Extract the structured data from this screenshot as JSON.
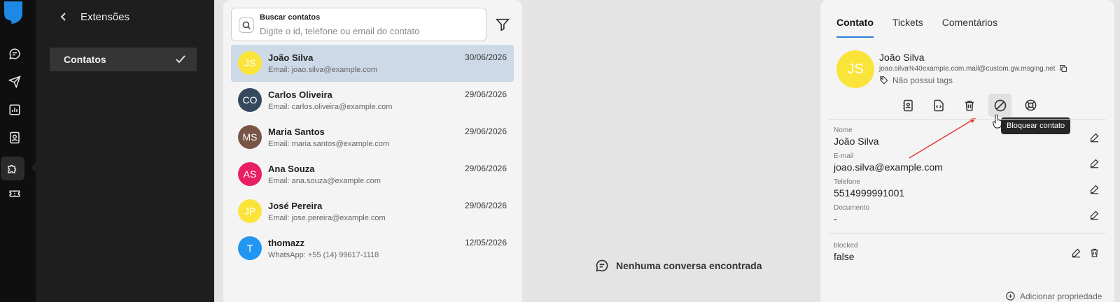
{
  "extensions": {
    "title": "Extensões",
    "items": [
      {
        "label": "Contatos"
      }
    ]
  },
  "search": {
    "label": "Buscar contatos",
    "placeholder": "Digite o id, telefone ou email do contato"
  },
  "contacts": [
    {
      "initials": "JS",
      "name": "João Silva",
      "sub": "Email: joao.silva@example.com",
      "date": "30/06/2026",
      "color": "#fbe43a",
      "selected": true
    },
    {
      "initials": "CO",
      "name": "Carlos Oliveira",
      "sub": "Email: carlos.oliveira@example.com",
      "date": "29/06/2026",
      "color": "#34495e"
    },
    {
      "initials": "MS",
      "name": "Maria Santos",
      "sub": "Email: maria.santos@example.com",
      "date": "29/06/2026",
      "color": "#795548"
    },
    {
      "initials": "AS",
      "name": "Ana Souza",
      "sub": "Email: ana.souza@example.com",
      "date": "29/06/2026",
      "color": "#e91e63"
    },
    {
      "initials": "JP",
      "name": "José Pereira",
      "sub": "Email: jose.pereira@example.com",
      "date": "29/06/2026",
      "color": "#fbe43a"
    },
    {
      "initials": "T",
      "name": "thomazz",
      "sub": "WhatsApp: +55 (14) 99617-1118",
      "date": "12/05/2026",
      "color": "#2196f3"
    }
  ],
  "empty_state": "Nenhuma conversa encontrada",
  "detail": {
    "tabs": [
      "Contato",
      "Tickets",
      "Comentários"
    ],
    "initials": "JS",
    "name": "João Silva",
    "identifier": "joao.silva%40example.com.mail@custom.gw.msging.net",
    "tags": "Não possui tags",
    "tooltip": "Bloquear contato",
    "fields": [
      {
        "label": "Nome",
        "value": "João Silva"
      },
      {
        "label": "E-mail",
        "value": "joao.silva@example.com"
      },
      {
        "label": "Telefone",
        "value": "5514999991001"
      },
      {
        "label": "Documento",
        "value": "-"
      }
    ],
    "extra": {
      "label": "blocked",
      "value": "false"
    },
    "add_property": "Adicionar propriedade"
  },
  "colors": {
    "accent": "#2f7fd8",
    "logo": "#1e88e5",
    "selected_row": "#cdd9e6"
  }
}
